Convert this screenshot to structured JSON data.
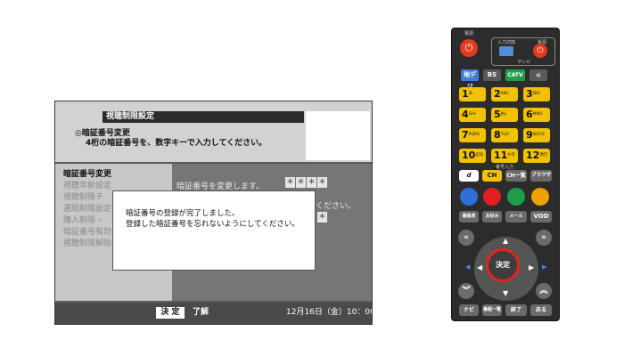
{
  "screen": {
    "title": "視聴制限設定",
    "instruction_1": "◎暗証番号変更",
    "instruction_2": "4桁の暗証番号を、数字キーで入力してください。",
    "menu": [
      {
        "label": "暗証番号変更",
        "active": true
      },
      {
        "label": "視聴年齢設定"
      },
      {
        "label": "視聴制限チ"
      },
      {
        "label": "選局制限設定"
      },
      {
        "label": "購入制限・"
      },
      {
        "label": "暗証番号有効"
      },
      {
        "label": "視聴制限解除"
      }
    ],
    "change_text": "暗証番号を変更します。",
    "pin_chars": [
      "＊",
      "＊",
      "＊",
      "＊"
    ],
    "pin_partial": "＊",
    "partial_text": "ください。",
    "dialog": {
      "line1": "暗証番号の登録が完了しました。",
      "line2": "登録した暗証番号を忘れないようにしてください。"
    },
    "footer": {
      "kettei_label": "決 定",
      "ryokai_label": "了解",
      "datetime": "12月16日（金）10：00"
    }
  },
  "remote": {
    "power_label": "電源",
    "input_label": "入力切換",
    "tv_power_label": "電源",
    "tv_label": "テレビ",
    "source_buttons": [
      "地デジ",
      "BS",
      "CATV",
      "⌂"
    ],
    "numbers": [
      {
        "n": "1",
        "sub": "あ"
      },
      {
        "n": "2",
        "sub": "ABC"
      },
      {
        "n": "3",
        "sub": "DEF"
      },
      {
        "n": "4",
        "sub": "GHI"
      },
      {
        "n": "5",
        "sub": "JKL"
      },
      {
        "n": "6",
        "sub": "MNO"
      },
      {
        "n": "7",
        "sub": "PQRS"
      },
      {
        "n": "8",
        "sub": "TUV"
      },
      {
        "n": "9",
        "sub": "WXYZ"
      },
      {
        "n": "10",
        "sub": "記号"
      },
      {
        "n": "11",
        "sub": "わをん"
      },
      {
        "n": "12",
        "sub": "改行"
      }
    ],
    "number_input_label": "番号入力",
    "mid_buttons": [
      "d",
      "CH",
      "CH一覧",
      "ブラウザ"
    ],
    "color_buttons": [
      "#2d6fd6",
      "#e02020",
      "#1e9e4a",
      "#f0a000"
    ],
    "row_buttons": [
      "番組表",
      "お好み",
      "メール",
      "VOD"
    ],
    "kettei_label": "決定",
    "bottom_buttons": [
      "ナビ",
      "番組一覧",
      "終了",
      "戻る"
    ],
    "colors": {
      "accent_ring": "#e8221a",
      "number_key": "#f2c200"
    }
  }
}
